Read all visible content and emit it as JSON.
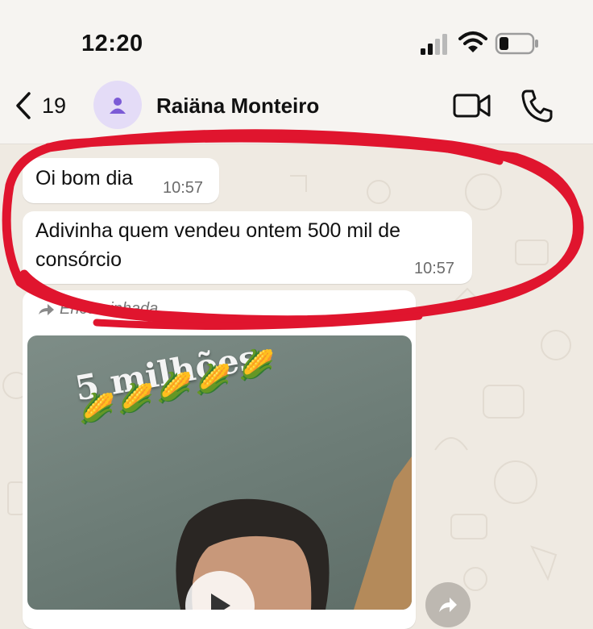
{
  "status_bar": {
    "time": "12:20"
  },
  "header": {
    "back_count": "19",
    "contact_name": "Raiäna Monteiro",
    "icons": [
      "back-chevron-icon",
      "avatar-person-icon",
      "video-call-icon",
      "phone-icon"
    ]
  },
  "messages": [
    {
      "text": "Oi bom dia",
      "time": "10:57"
    },
    {
      "text": "Adivinha quem vendeu ontem 500 mil de consórcio",
      "time": "10:57"
    }
  ],
  "forwarded": {
    "label": "Encaminhada"
  },
  "media": {
    "caption": "5 milhões",
    "emoji": "🌽"
  },
  "colors": {
    "chat_background": "#efeae2",
    "bubble": "#ffffff",
    "avatar_bg": "#e4dcf7",
    "avatar_icon": "#7b5bd6",
    "annotation": "#e0152e"
  }
}
